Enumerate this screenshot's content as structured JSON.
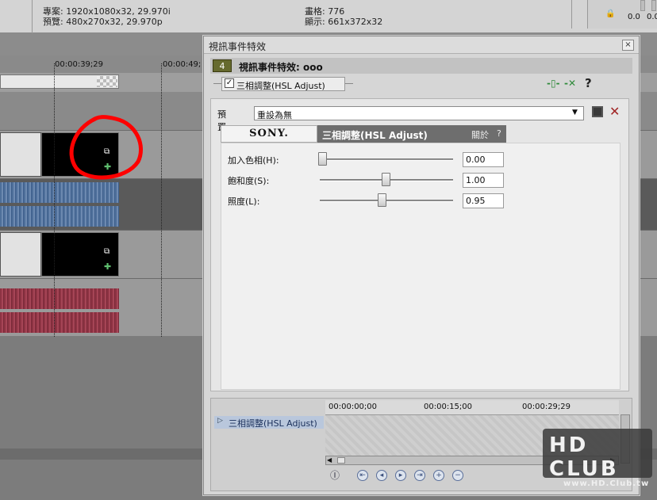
{
  "top_info": {
    "project_label": "專案: 1920x1080x32, 29.970i",
    "preview_label": "預覽: 480x270x32, 29.970p",
    "frame_label": "畫格: 776",
    "display_label": "顯示: 661x372x32",
    "meter_left": "0.0",
    "meter_right": "0.0"
  },
  "timeline": {
    "ruler_times": [
      "00:00:39;29",
      "00:00:49;"
    ]
  },
  "dialog": {
    "title": "視訊事件特效",
    "close_glyph": "×",
    "event_number": "4",
    "event_title": "視訊事件特效: ooo",
    "chain_item_label": "三相調整(HSL Adjust)",
    "preset_label": "預置:",
    "preset_value": "重設為無",
    "vendor_logo": "SONY.",
    "plugin_title": "三相調整(HSL Adjust)",
    "about_label": "關於",
    "help_label": "?",
    "params": [
      {
        "name": "加入色相(H):",
        "value": "0.00"
      },
      {
        "name": "飽和度(S):",
        "value": "1.00"
      },
      {
        "name": "照度(L):",
        "value": "0.95"
      }
    ],
    "keyframes": {
      "track_label": "三相調整(HSL Adjust)",
      "times": [
        "00:00:00;00",
        "00:00:15;00",
        "00:00:29;29"
      ]
    }
  },
  "watermark": {
    "brand": "HD CLUB",
    "url": "www.HD.Club.tw"
  },
  "colors": {
    "badge": "#666a2e",
    "plugin_title_bg": "#6e6e6e",
    "annotation_red": "#ff0000",
    "keyframe_blue": "#5a6f9a"
  }
}
